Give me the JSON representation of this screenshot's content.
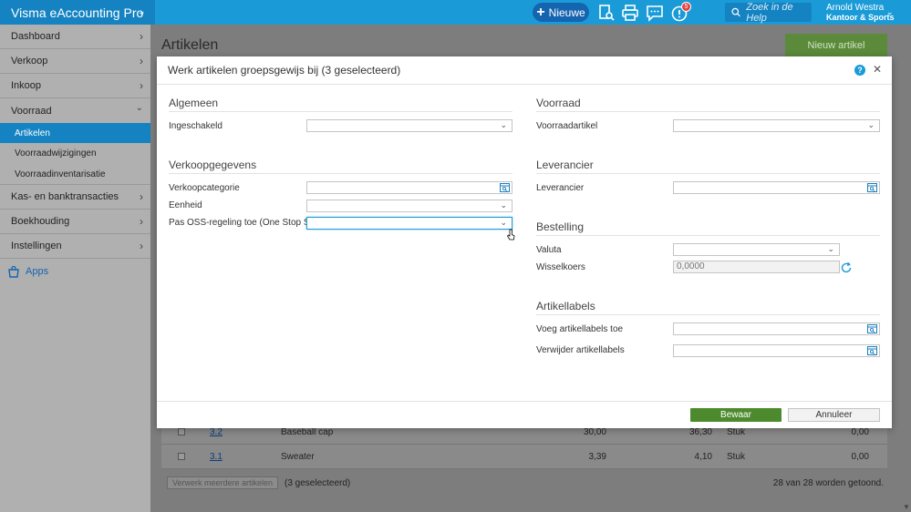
{
  "app": {
    "name": "Visma eAccounting Pro",
    "new_label": "Nieuwe",
    "notification_count": "5",
    "search_placeholder": "Zoek in de Help",
    "user_name": "Arnold Westra",
    "company": "Kantoor & Sports"
  },
  "sidebar": {
    "items": [
      {
        "label": "Dashboard"
      },
      {
        "label": "Verkoop"
      },
      {
        "label": "Inkoop"
      },
      {
        "label": "Voorraad"
      }
    ],
    "subitems": [
      {
        "label": "Artikelen"
      },
      {
        "label": "Voorraadwijzigingen"
      },
      {
        "label": "Voorraadinventarisatie"
      }
    ],
    "items_after": [
      {
        "label": "Kas- en banktransacties"
      },
      {
        "label": "Boekhouding"
      },
      {
        "label": "Instellingen"
      }
    ],
    "apps_label": "Apps"
  },
  "page": {
    "title": "Artikelen",
    "new_button": "Nieuw artikel",
    "rows": [
      {
        "code": "3.2",
        "name": "Baseball cap",
        "v1": "30,00",
        "v2": "36,30",
        "unit": "Stuk",
        "v3": "0,00"
      },
      {
        "code": "3.1",
        "name": "Sweater",
        "v1": "3,39",
        "v2": "4,10",
        "unit": "Stuk",
        "v3": "0,00"
      }
    ],
    "bulk_button": "Verwerk meerdere artikelen",
    "selected_count": "(3 geselecteerd)",
    "total_count": "28 van 28 worden getoond."
  },
  "modal": {
    "title": "Werk artikelen groepsgewijs bij (3 geselecteerd)",
    "general": {
      "title": "Algemeen",
      "enabled_label": "Ingeschakeld"
    },
    "sales": {
      "title": "Verkoopgegevens",
      "category_label": "Verkoopcategorie",
      "unit_label": "Eenheid",
      "oss_label": "Pas OSS-regeling toe (One Stop Sh..."
    },
    "stock": {
      "title": "Voorraad",
      "stock_item_label": "Voorraadartikel"
    },
    "supplier": {
      "title": "Leverancier",
      "supplier_label": "Leverancier"
    },
    "order": {
      "title": "Bestelling",
      "currency_label": "Valuta",
      "rate_label": "Wisselkoers",
      "rate_value": "0,0000"
    },
    "labels": {
      "title": "Artikellabels",
      "add_label": "Voeg artikellabels toe",
      "remove_label": "Verwijder artikellabels"
    },
    "save_button": "Bewaar",
    "cancel_button": "Annuleer"
  }
}
